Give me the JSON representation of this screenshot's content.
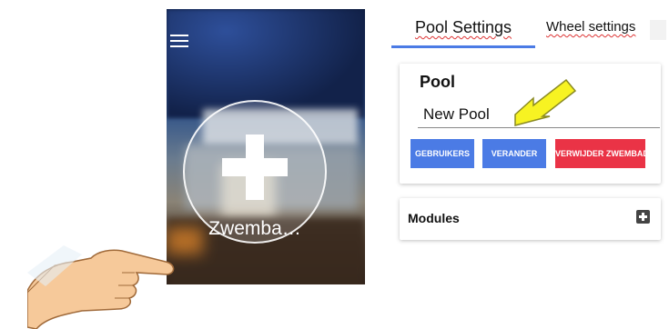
{
  "home": {
    "add_pool_label": "Zwemba…",
    "menu_icon": "hamburger-icon",
    "add_icon": "plus-icon"
  },
  "tabs": [
    {
      "label": "Pool Settings",
      "active": true
    },
    {
      "label": "Wheel settings",
      "active": false
    }
  ],
  "pool_card": {
    "title": "Pool",
    "name_value": "New Pool",
    "buttons": {
      "users": "GEBRUIKERS",
      "change": "VERANDER",
      "delete": "VERWIJDER ZWEMBAD"
    }
  },
  "modules_card": {
    "title": "Modules",
    "add_icon": "plus-square-icon"
  },
  "colors": {
    "accent_blue": "#4b7be5",
    "danger_red": "#ea3346",
    "arrow_yellow": "#f7f322"
  }
}
